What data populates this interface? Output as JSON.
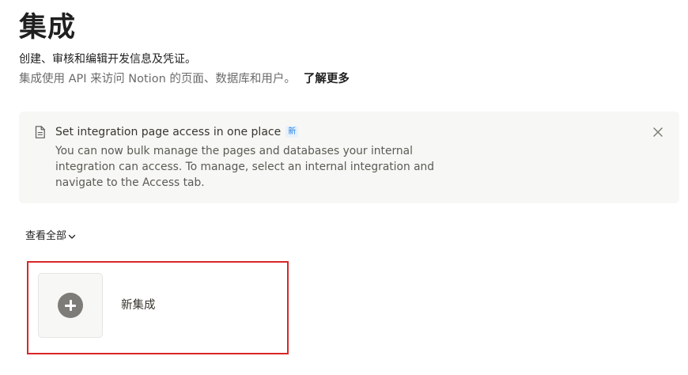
{
  "header": {
    "title": "集成",
    "subtitle": "创建、审核和编辑开发信息及凭证。",
    "description": "集成使用 API 来访问 Notion 的页面、数据库和用户。",
    "learn_more": "了解更多"
  },
  "callout": {
    "icon": "document-icon",
    "title": "Set integration page access in one place",
    "badge": "新",
    "body": "You can now bulk manage the pages and databases your internal integration can access. To manage, select an internal integration and navigate to the Access tab.",
    "close_icon": "close-icon"
  },
  "filter": {
    "view_all_label": "查看全部"
  },
  "new_integration": {
    "label": "新集成",
    "icon": "plus-circle-icon"
  },
  "colors": {
    "callout_bg": "#f7f7f5",
    "badge_bg": "#e7f1fb",
    "badge_text": "#2383e2",
    "highlight_border": "#d9262a",
    "plus_circle": "#7d7c78"
  }
}
